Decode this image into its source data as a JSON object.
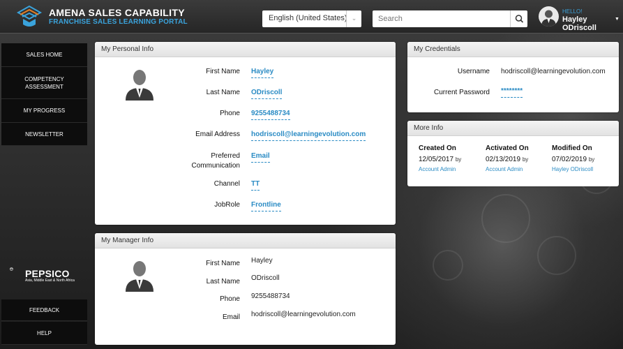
{
  "header": {
    "brand_title": "AMENA SALES CAPABILITY",
    "brand_subtitle": "FRANCHISE SALES LEARNING PORTAL",
    "language": "English (United States)",
    "search_placeholder": "Search",
    "hello": "HELLO!",
    "user_name": "Hayley ODriscoll"
  },
  "sidebar": {
    "items": [
      {
        "label": "SALES HOME"
      },
      {
        "label": "COMPETENCY ASSESSMENT"
      },
      {
        "label": "MY PROGRESS"
      },
      {
        "label": "NEWSLETTER"
      }
    ],
    "bottom": [
      {
        "label": "FEEDBACK"
      },
      {
        "label": "HELP"
      }
    ],
    "sponsor": {
      "name": "PEPSICO",
      "region": "Asia, Middle East & North Africa"
    }
  },
  "personal_info": {
    "title": "My Personal Info",
    "fields": [
      {
        "label": "First Name",
        "value": "Hayley"
      },
      {
        "label": "Last Name",
        "value": "ODriscoll"
      },
      {
        "label": "Phone",
        "value": "9255488734"
      },
      {
        "label": "Email Address",
        "value": "hodriscoll@learningevolution.com"
      },
      {
        "label": "Preferred Communication",
        "value": "Email"
      },
      {
        "label": "Channel",
        "value": "TT"
      },
      {
        "label": "JobRole",
        "value": "Frontline"
      }
    ]
  },
  "manager_info": {
    "title": "My Manager Info",
    "fields": [
      {
        "label": "First Name",
        "value": "Hayley"
      },
      {
        "label": "Last Name",
        "value": "ODriscoll"
      },
      {
        "label": "Phone",
        "value": "9255488734"
      },
      {
        "label": "Email",
        "value": "hodriscoll@learningevolution.com"
      }
    ]
  },
  "credentials": {
    "title": "My Credentials",
    "username_label": "Username",
    "username": "hodriscoll@learningevolution.com",
    "password_label": "Current Password",
    "password": "********"
  },
  "more_info": {
    "title": "More Info",
    "by": "by",
    "items": [
      {
        "heading": "Created On",
        "date": "12/05/2017",
        "by": "Account Admin"
      },
      {
        "heading": "Activated On",
        "date": "02/13/2019",
        "by": "Account Admin"
      },
      {
        "heading": "Modified On",
        "date": "07/02/2019",
        "by": "Hayley ODriscoll"
      }
    ]
  },
  "colors": {
    "accent": "#2a8bc4",
    "brand_blue": "#3aa3dc",
    "sidebar": "#0d0d0d"
  }
}
